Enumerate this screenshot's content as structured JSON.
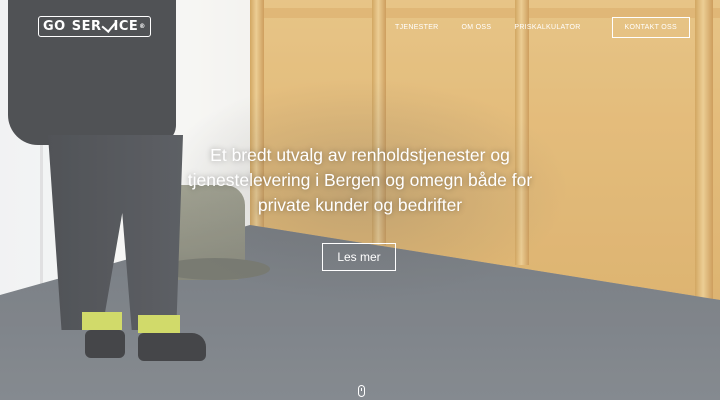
{
  "header": {
    "logo_text_left": "GO",
    "logo_text_right": "SER",
    "logo_text_end": "ICE",
    "logo_reg": "®",
    "nav": [
      {
        "label": "TJENESTER"
      },
      {
        "label": "OM OSS"
      },
      {
        "label": "PRISKALKULATOR"
      }
    ],
    "cta_label": "KONTAKT OSS"
  },
  "hero": {
    "headline": "Et bredt utvalg av renholdstjenester og tjenestelevering i Bergen og omegn både for private kunder og bedrifter",
    "button_label": "Les mer"
  },
  "colors": {
    "text": "#ffffff",
    "wood": "#deae5f",
    "floor": "#5b6168"
  },
  "icons": {
    "scroll": "mouse-scroll-icon",
    "logo_check": "checkmark-icon"
  }
}
